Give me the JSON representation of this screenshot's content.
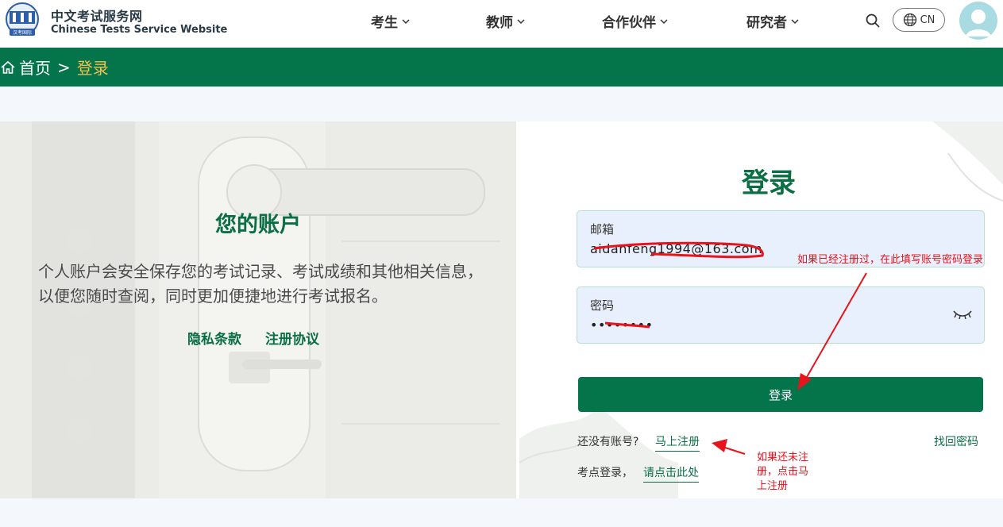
{
  "header": {
    "logo_zh": "中文考试服务网",
    "logo_en": "Chinese Tests Service Website",
    "logo_badge": "汉考国际",
    "nav": [
      "考生",
      "教师",
      "合作伙伴",
      "研究者"
    ],
    "lang": "CN"
  },
  "breadcrumb": {
    "home": "首页",
    "separator": ">",
    "current": "登录"
  },
  "left": {
    "title": "您的账户",
    "desc": "个人账户会安全保存您的考试记录、考试成绩和其他相关信息，以便您随时查阅，同时更加便捷地进行考试报名。",
    "privacy": "隐私条款",
    "agreement": "注册协议"
  },
  "login": {
    "title": "登录",
    "email_label": "邮箱",
    "email_value": "aidanfeng1994@163.com",
    "password_label": "密码",
    "password_value": "••••••••",
    "submit": "登录",
    "no_account": "还没有账号?",
    "register_link": "马上注册",
    "forgot": "找回密码",
    "center_login": "考点登录，",
    "center_link": "请点击此处"
  },
  "annotations": {
    "login_note": "如果已经注册过，在此填写账号密码登录",
    "register_note_1": "如果还未注",
    "register_note_2": "册，点击马",
    "register_note_3": "上注册"
  },
  "colors": {
    "brand_green": "#04754a",
    "crumb_current": "#f2c04d",
    "annotation_red": "#e8141b"
  }
}
